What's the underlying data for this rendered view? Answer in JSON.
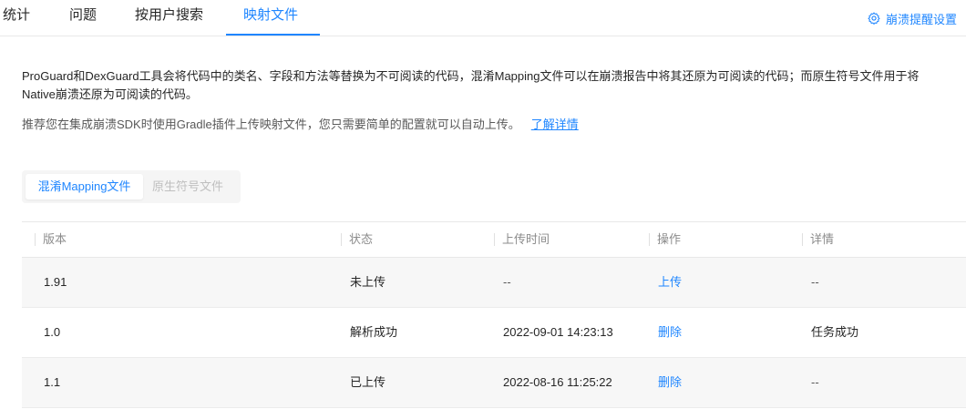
{
  "tabs": [
    {
      "label": "统计",
      "active": false
    },
    {
      "label": "问题",
      "active": false
    },
    {
      "label": "按用户搜索",
      "active": false
    },
    {
      "label": "映射文件",
      "active": true
    }
  ],
  "settings_link": {
    "label": "崩溃提醒设置",
    "icon": "gear-icon"
  },
  "description": {
    "text": "ProGuard和DexGuard工具会将代码中的类名、字段和方法等替换为不可阅读的代码，混淆Mapping文件可以在崩溃报告中将其还原为可阅读的代码；而原生符号文件用于将Native崩溃还原为可阅读的代码。",
    "tip": "推荐您在集成崩溃SDK时使用Gradle插件上传映射文件，您只需要简单的配置就可以自动上传。",
    "learn_more": "了解详情"
  },
  "segments": [
    {
      "label": "混淆Mapping文件",
      "active": true
    },
    {
      "label": "原生符号文件",
      "active": false
    }
  ],
  "table": {
    "columns": [
      "版本",
      "状态",
      "上传时间",
      "操作",
      "详情"
    ],
    "rows": [
      {
        "version": "1.91",
        "status": "未上传",
        "time": "--",
        "action": "上传",
        "detail": "--"
      },
      {
        "version": "1.0",
        "status": "解析成功",
        "time": "2022-09-01 14:23:13",
        "action": "删除",
        "detail": "任务成功"
      },
      {
        "version": "1.1",
        "status": "已上传",
        "time": "2022-08-16 11:25:22",
        "action": "删除",
        "detail": "--"
      }
    ]
  },
  "colors": {
    "accent": "#1f86ff",
    "text": "#262626",
    "muted": "#8c8c8c",
    "row_shade": "#f7f7f7"
  }
}
